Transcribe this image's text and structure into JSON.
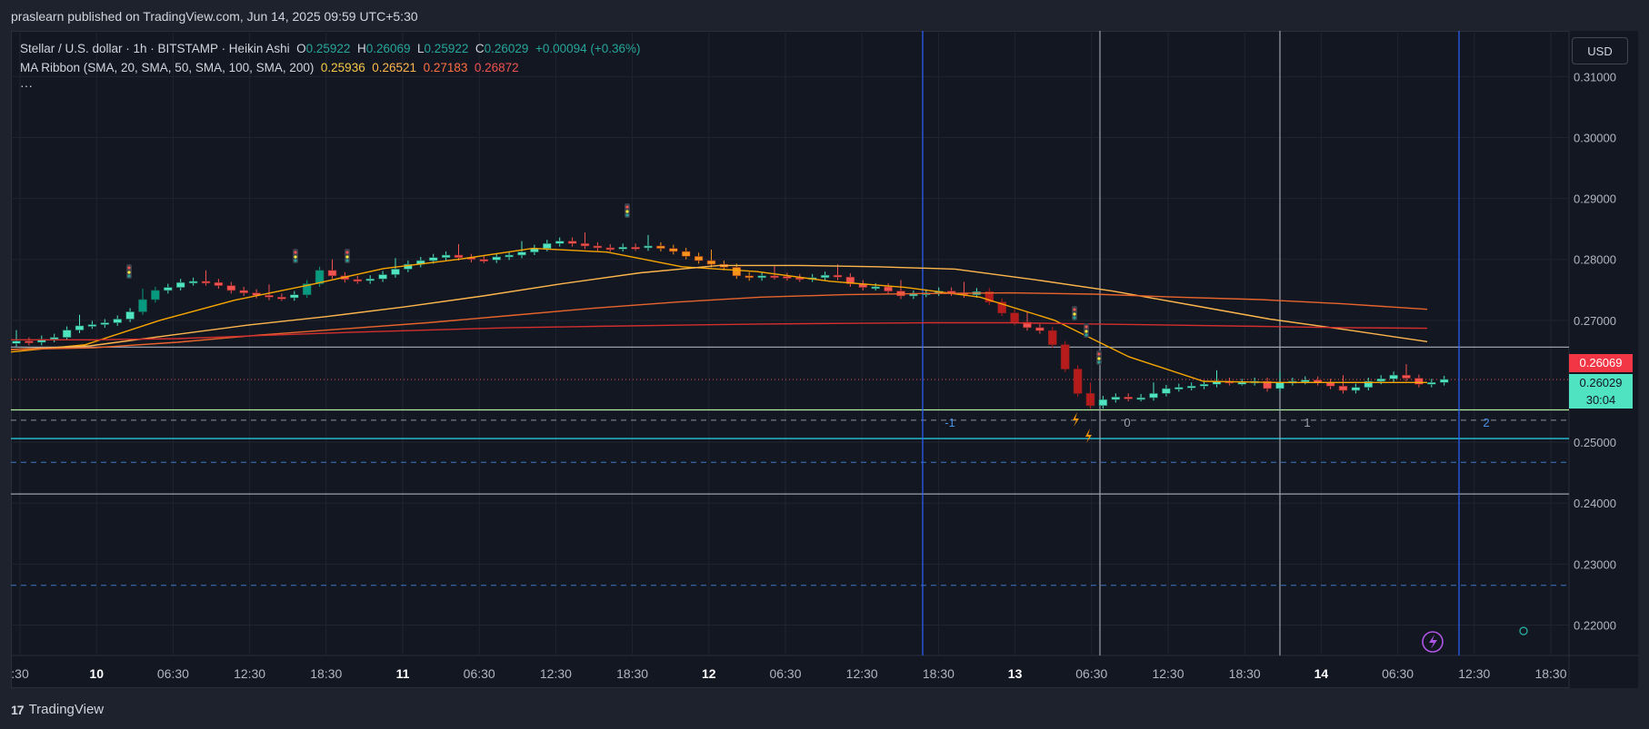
{
  "header": {
    "publisher_text": "praslearn published on TradingView.com, Jun 14, 2025 09:59 UTC+5:30"
  },
  "legend": {
    "symbol": "Stellar / U.S. dollar · 1h · BITSTAMP · Heikin Ashi",
    "o_label": "O",
    "o_value": "0.25922",
    "h_label": "H",
    "h_value": "0.26069",
    "l_label": "L",
    "l_value": "0.25922",
    "c_label": "C",
    "c_value": "0.26029",
    "change": "+0.00094 (+0.36%)",
    "ma_title": "MA Ribbon (SMA, 20, SMA, 50, SMA, 100, SMA, 200)",
    "ma_values": [
      "0.25936",
      "0.26521",
      "0.27183",
      "0.26872"
    ],
    "more": "···"
  },
  "currency_button": "USD",
  "price_labels": {
    "high": "0.26069",
    "last": "0.26029",
    "countdown": "30:04"
  },
  "colors": {
    "background": "#131722",
    "up": "#4fe3c2",
    "down": "#f05350",
    "up_strong": "#089981",
    "down_strong": "#b71c1c",
    "ma20": "#f7a600",
    "ma50": "#ffb74d",
    "ma100": "#e8642c",
    "ma200": "#d32f2f",
    "accent_line": "#b2f0a0",
    "teal_line": "#26c6da",
    "fib_line": "#2962ff"
  },
  "brand": {
    "name": "TradingView"
  },
  "chart_data": {
    "type": "candlestick",
    "title": "Stellar / U.S. dollar · 1h · BITSTAMP · Heikin Ashi",
    "ylim": [
      0.215,
      0.3175
    ],
    "y_ticks": [
      "0.31000",
      "0.30000",
      "0.29000",
      "0.28000",
      "0.27000",
      "0.25000",
      "0.24000",
      "0.23000",
      "0.22000"
    ],
    "x_ticks": [
      ":30",
      "10",
      "06:30",
      "12:30",
      "18:30",
      "11",
      "06:30",
      "12:30",
      "18:30",
      "12",
      "06:30",
      "12:30",
      "18:30",
      "13",
      "06:30",
      "12:30",
      "18:30",
      "14",
      "06:30",
      "12:30",
      "18:30"
    ],
    "x_tick_bold": [
      false,
      true,
      false,
      false,
      false,
      true,
      false,
      false,
      false,
      true,
      false,
      false,
      false,
      true,
      false,
      false,
      false,
      true,
      false,
      false,
      false
    ],
    "candle_count": 114,
    "closes": [
      0.2666,
      0.2664,
      0.2669,
      0.2672,
      0.2684,
      0.2691,
      0.2693,
      0.2696,
      0.2702,
      0.2714,
      0.2734,
      0.2749,
      0.2754,
      0.2762,
      0.2764,
      0.2762,
      0.2757,
      0.2749,
      0.2745,
      0.2741,
      0.2738,
      0.2737,
      0.2742,
      0.276,
      0.2782,
      0.2773,
      0.2767,
      0.2765,
      0.2768,
      0.2775,
      0.2784,
      0.2792,
      0.2798,
      0.2803,
      0.2807,
      0.2803,
      0.28,
      0.2799,
      0.2804,
      0.2807,
      0.2812,
      0.2818,
      0.2826,
      0.283,
      0.2826,
      0.2822,
      0.2819,
      0.2818,
      0.282,
      0.2819,
      0.2822,
      0.2818,
      0.2813,
      0.2805,
      0.2798,
      0.2792,
      0.2787,
      0.2773,
      0.277,
      0.2773,
      0.2772,
      0.277,
      0.2768,
      0.277,
      0.2774,
      0.2771,
      0.276,
      0.2754,
      0.2755,
      0.2748,
      0.274,
      0.2743,
      0.2745,
      0.2748,
      0.2745,
      0.2742,
      0.2747,
      0.273,
      0.2712,
      0.2697,
      0.2688,
      0.2683,
      0.266,
      0.262,
      0.258,
      0.256,
      0.257,
      0.2574,
      0.2572,
      0.2573,
      0.258,
      0.2588,
      0.259,
      0.2592,
      0.2595,
      0.26,
      0.2598,
      0.2598,
      0.26,
      0.2588,
      0.2598,
      0.26,
      0.2602,
      0.2598,
      0.2592,
      0.2585,
      0.259,
      0.26,
      0.2604,
      0.261,
      0.2605,
      0.2595,
      0.2598,
      0.2603
    ],
    "ma_series": [
      {
        "name": "SMA 20",
        "values": [
          0.2648,
          0.266,
          0.27,
          0.2733,
          0.2758,
          0.2785,
          0.28,
          0.2818,
          0.2812,
          0.2788,
          0.278,
          0.2764,
          0.2754,
          0.2738,
          0.27,
          0.264,
          0.26,
          0.2598,
          0.2598,
          0.2598
        ]
      },
      {
        "name": "SMA 50",
        "values": [
          0.2652,
          0.2658,
          0.2675,
          0.2692,
          0.2706,
          0.2722,
          0.274,
          0.276,
          0.2778,
          0.279,
          0.279,
          0.2788,
          0.2784,
          0.2767,
          0.2748,
          0.2725,
          0.2702,
          0.2684,
          0.2665
        ]
      },
      {
        "name": "SMA 100",
        "values": [
          0.2652,
          0.2655,
          0.2664,
          0.2676,
          0.2686,
          0.2696,
          0.2708,
          0.272,
          0.273,
          0.2738,
          0.2742,
          0.2744,
          0.2745,
          0.2743,
          0.2738,
          0.2734,
          0.2727,
          0.2718
        ]
      },
      {
        "name": "SMA 200",
        "values": [
          0.2668,
          0.2668,
          0.267,
          0.2675,
          0.268,
          0.2684,
          0.2688,
          0.269,
          0.2692,
          0.2694,
          0.2695,
          0.2696,
          0.2696,
          0.2694,
          0.2692,
          0.269,
          0.2688,
          0.2687
        ]
      }
    ],
    "horizontal_levels": [
      0.2656,
      0.2553,
      0.2506,
      0.2415
    ],
    "dashed_levels": [
      0.2536,
      0.2467,
      0.2265
    ],
    "fib_time_labels": [
      "-1",
      "0",
      "1",
      "2"
    ]
  }
}
